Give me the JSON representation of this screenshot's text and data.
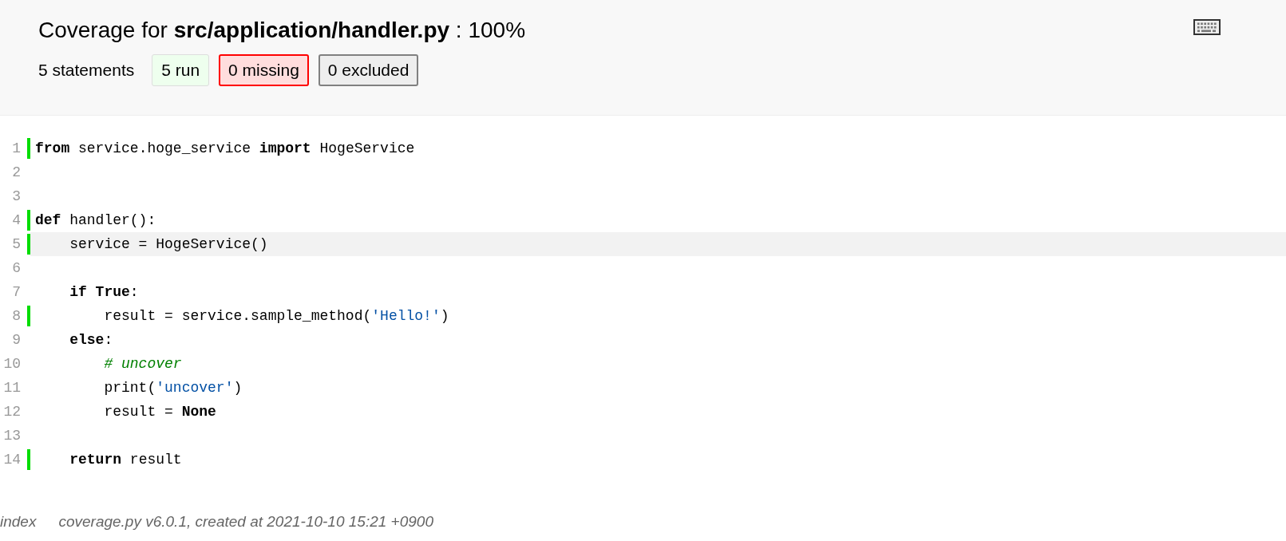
{
  "header": {
    "title": "Coverage for **src/application/handler.py** : 100%",
    "statements": "5 statements",
    "filters": [
      {
        "kind": "run",
        "label": "5 run",
        "selected": false
      },
      {
        "kind": "mis",
        "label": "0 missing",
        "selected": true
      },
      {
        "kind": "exc",
        "label": "0 excluded",
        "selected": true
      }
    ]
  },
  "code": [
    {
      "number": "1",
      "run": true,
      "highlighted": false,
      "tokens": [
        {
          "kind": "kw",
          "text": "from"
        },
        {
          "kind": "txt",
          "text": " service.hoge_service "
        },
        {
          "kind": "kw",
          "text": "import"
        },
        {
          "kind": "txt",
          "text": " HogeService"
        }
      ]
    },
    {
      "number": "2",
      "run": false,
      "highlighted": false
    },
    {
      "number": "3",
      "run": false,
      "highlighted": false
    },
    {
      "number": "4",
      "run": true,
      "highlighted": false,
      "tokens": [
        {
          "kind": "kw",
          "text": "def"
        },
        {
          "kind": "txt",
          "text": " handler():"
        }
      ]
    },
    {
      "number": "5",
      "run": true,
      "highlighted": true,
      "tokens": [
        {
          "kind": "txt",
          "text": "    service = HogeService()"
        }
      ]
    },
    {
      "number": "6",
      "run": false,
      "highlighted": false
    },
    {
      "number": "7",
      "run": false,
      "highlighted": false,
      "tokens": [
        {
          "kind": "kw",
          "text": "    if"
        },
        {
          "kind": "kw",
          "text": " True"
        },
        {
          "kind": "txt",
          "text": ":"
        }
      ]
    },
    {
      "number": "8",
      "run": true,
      "highlighted": false,
      "tokens": [
        {
          "kind": "txt",
          "text": "        result = service.sample_method("
        },
        {
          "kind": "str",
          "text": "'Hello!'"
        },
        {
          "kind": "txt",
          "text": ")"
        }
      ]
    },
    {
      "number": "9",
      "run": false,
      "highlighted": false,
      "tokens": [
        {
          "kind": "kw",
          "text": "    else"
        },
        {
          "kind": "txt",
          "text": ":"
        }
      ]
    },
    {
      "number": "10",
      "run": false,
      "highlighted": false,
      "tokens": [
        {
          "kind": "com",
          "text": "        # uncover"
        }
      ]
    },
    {
      "number": "11",
      "run": false,
      "highlighted": false,
      "tokens": [
        {
          "kind": "txt",
          "text": "        print("
        },
        {
          "kind": "str",
          "text": "'uncover'"
        },
        {
          "kind": "txt",
          "text": ")"
        }
      ]
    },
    {
      "number": "12",
      "run": false,
      "highlighted": false,
      "tokens": [
        {
          "kind": "txt",
          "text": "        result = "
        },
        {
          "kind": "kw",
          "text": "None"
        }
      ]
    },
    {
      "number": "13",
      "run": false,
      "highlighted": false
    },
    {
      "number": "14",
      "run": true,
      "highlighted": false,
      "tokens": [
        {
          "kind": "kw",
          "text": "    return"
        },
        {
          "kind": "txt",
          "text": " result"
        }
      ]
    }
  ],
  "footer": {
    "link": "index",
    "created": "coverage.py v6.0.1, created at 2021-10-10 15:21 +0900"
  }
}
